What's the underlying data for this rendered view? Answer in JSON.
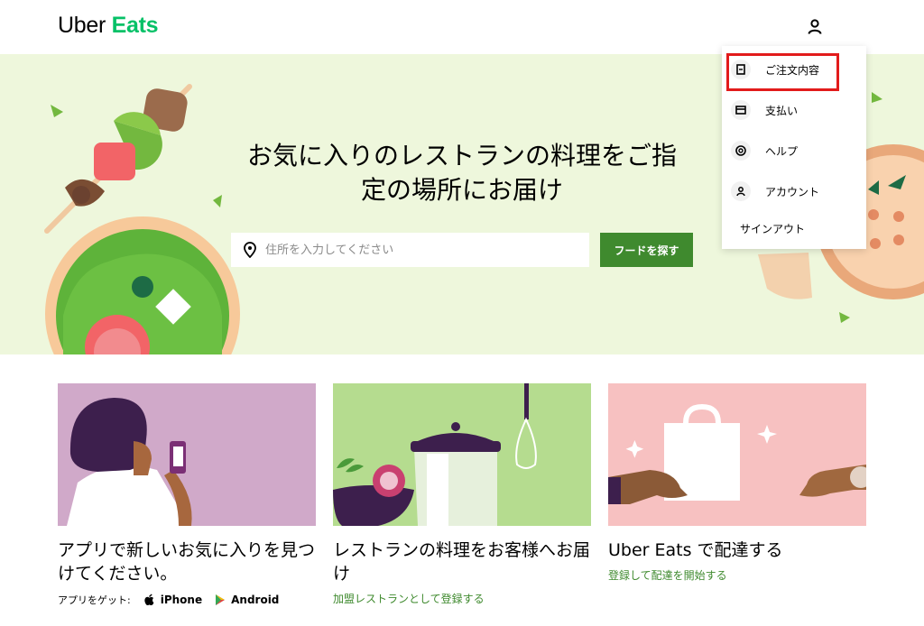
{
  "header": {
    "logo_part1": "Uber",
    "logo_part2": "Eats",
    "user_icon": "person-icon"
  },
  "hero": {
    "title_line1": "お気に入りのレストランの料理をご指",
    "title_line2": "定の場所にお届け",
    "search_placeholder": "住所を入力してください",
    "search_value": "",
    "find_button": "フードを探す"
  },
  "menu": {
    "items": [
      {
        "label": "ご注文内容",
        "icon": "receipt-icon"
      },
      {
        "label": "支払い",
        "icon": "credit-card-icon"
      },
      {
        "label": "ヘルプ",
        "icon": "lifebuoy-icon"
      },
      {
        "label": "アカウント",
        "icon": "person-icon"
      },
      {
        "label": "サインアウト",
        "icon": ""
      }
    ]
  },
  "cards": [
    {
      "title": "アプリで新しいお気に入りを見つけてください。",
      "app_label": "アプリをゲット:",
      "iphone": "iPhone",
      "android": "Android"
    },
    {
      "title": "レストランの料理をお客様へお届け",
      "link": "加盟レストランとして登録する"
    },
    {
      "title": "Uber Eats で配達する",
      "link": "登録して配達を開始する"
    }
  ],
  "colors": {
    "brand_green": "#06c167",
    "button_green": "#3f8a2e",
    "hero_bg": "#eef7dc",
    "highlight": "#e21b1b"
  }
}
